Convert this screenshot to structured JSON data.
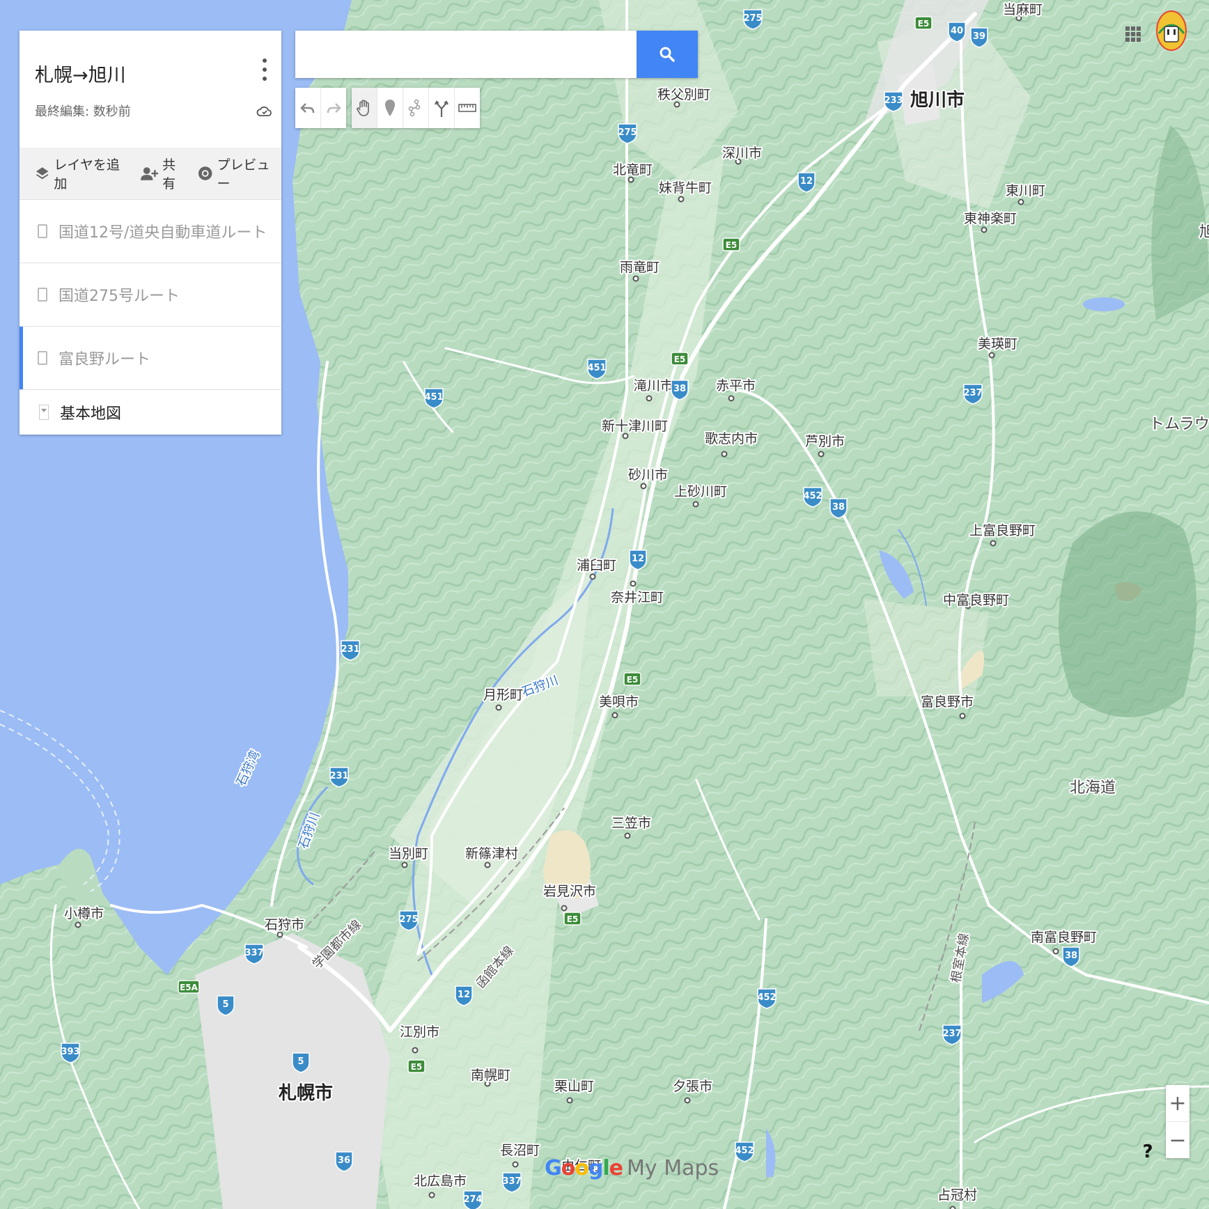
{
  "panel": {
    "title": "札幌→旭川",
    "subtitle": "最終編集: 数秒前",
    "actions": {
      "add_layer": "レイヤを追加",
      "share": "共有",
      "preview": "プレビュー"
    },
    "layers": [
      {
        "label": "国道12号/道央自動車道ルート",
        "active": false
      },
      {
        "label": "国道275号ルート",
        "active": false
      },
      {
        "label": "富良野ルート",
        "active": true
      }
    ],
    "basemap_label": "基本地図"
  },
  "search": {
    "placeholder": "",
    "value": ""
  },
  "zoom": {
    "in_label": "+",
    "out_label": "−"
  },
  "help_label": "?",
  "logo": {
    "google": "Google",
    "mymaps": "My Maps"
  },
  "colors": {
    "water": "#9bbcf5",
    "land": "#b7dcc0",
    "accent": "#4285f4",
    "expressway": "#3d8c3a",
    "route_shield": "#3a8cc8"
  },
  "map_labels": {
    "cities": [
      "札幌市",
      "旭川市",
      "小樽市",
      "石狩市",
      "江別市",
      "岩見沢市",
      "美唄市",
      "三笠市",
      "砂川市",
      "滝川市",
      "赤平市",
      "芦別市",
      "歌志内市",
      "深川市",
      "富良野市",
      "北広島市",
      "夕張市"
    ],
    "towns": [
      "当麻町",
      "秩父別町",
      "北竜町",
      "妹背牛町",
      "雨竜町",
      "東川町",
      "東神楽町",
      "美瑛町",
      "新十津川町",
      "上砂川町",
      "浦臼町",
      "奈井江町",
      "上富良野町",
      "中富良野町",
      "月形町",
      "当別町",
      "新篠津村",
      "南幌町",
      "栗山町",
      "長沼町",
      "南富良野町",
      "占冠村",
      "由仁町"
    ],
    "region": [
      "北海道",
      "トムラウシ",
      "旭"
    ],
    "water": [
      "石狩川",
      "石狩湾",
      "石狩川"
    ],
    "rail": [
      "学園都市線",
      "函館本線",
      "根室本線"
    ],
    "routes": [
      "275",
      "40",
      "39",
      "233",
      "12",
      "451",
      "38",
      "237",
      "452",
      "231",
      "337",
      "5",
      "393",
      "36",
      "274"
    ],
    "expressways": [
      "E5",
      "E5A"
    ]
  }
}
